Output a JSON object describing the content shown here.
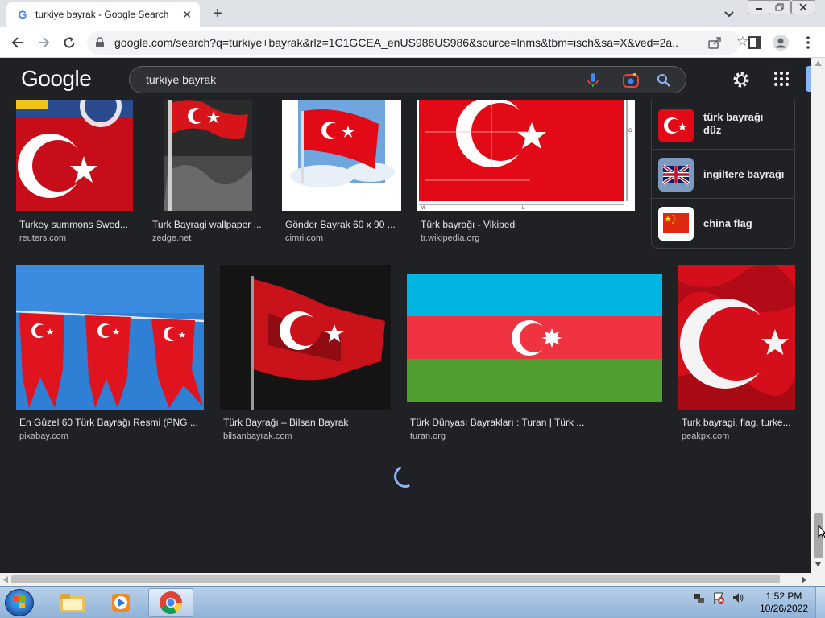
{
  "browser": {
    "tab_title": "turkiye bayrak - Google Search",
    "tab_favicon": "G",
    "new_tab_label": "+",
    "url": "google.com/search?q=turkiye+bayrak&rlz=1C1GCEA_enUS986US986&source=lnms&tbm=isch&sa=X&ved=2a..."
  },
  "google": {
    "logo": "Google",
    "query": "turkiye bayrak"
  },
  "results_row1": [
    {
      "title": "Turkey summons Swed...",
      "source": "reuters.com"
    },
    {
      "title": "Turk Bayragi wallpaper ...",
      "source": "zedge.net"
    },
    {
      "title": "Gönder Bayrak 60 x 90 ...",
      "source": "cimri.com"
    },
    {
      "title": "Türk bayrağı - Vikipedi",
      "source": "tr.wikipedia.org"
    }
  ],
  "related_searches": [
    {
      "label": "türk bayrağı düz"
    },
    {
      "label": "ingiltere bayrağı"
    },
    {
      "label": "china flag"
    }
  ],
  "results_row2": [
    {
      "title": "En Güzel 60 Türk Bayrağı Resmi (PNG ...",
      "source": "pixabay.com"
    },
    {
      "title": "Türk Bayrağı – Bilsan Bayrak",
      "source": "bilsanbayrak.com"
    },
    {
      "title": "Türk Dünyası Bayrakları : Turan | Türk ...",
      "source": "turan.org"
    },
    {
      "title": "Turk bayragi, flag, turke...",
      "source": "peakpx.com"
    }
  ],
  "taskbar": {
    "time": "1:52 PM",
    "date": "10/26/2022"
  },
  "colors": {
    "page_bg": "#202124",
    "turkish_red": "#e30a17",
    "azerbaijan_blue": "#00b5e2",
    "azerbaijan_green": "#3f9c35"
  }
}
